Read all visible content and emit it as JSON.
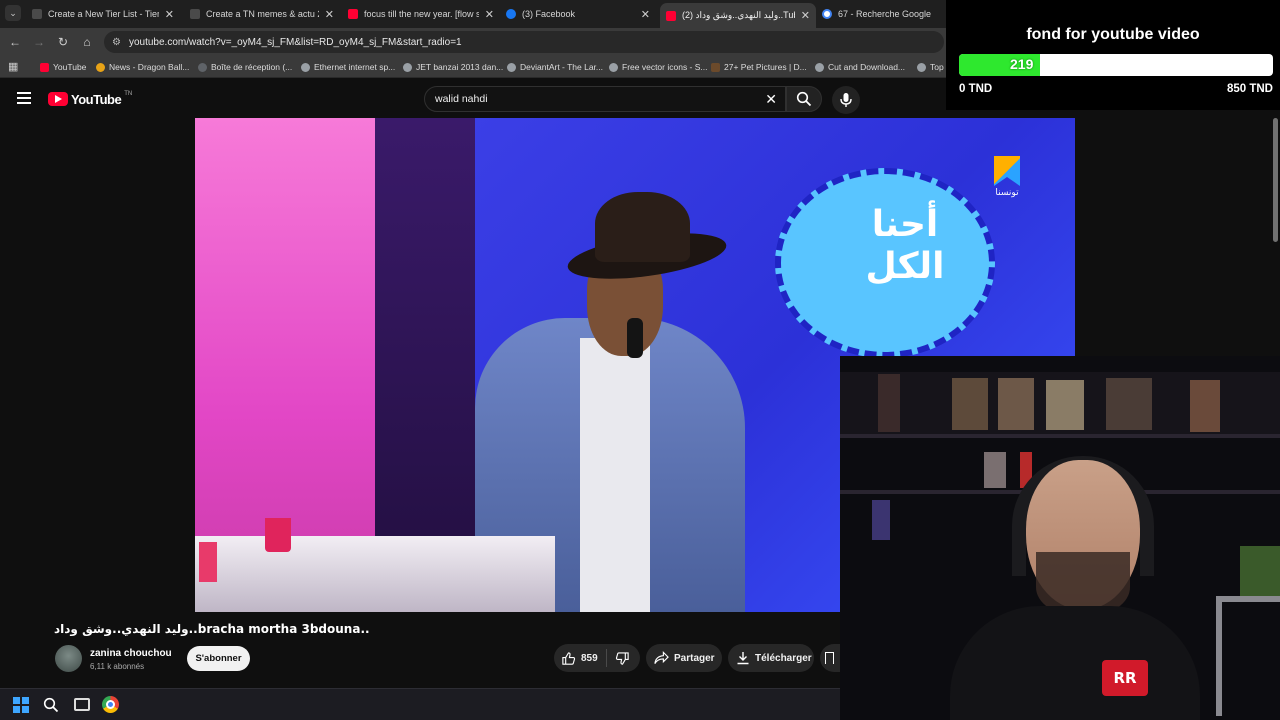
{
  "browser": {
    "tabs": [
      {
        "title": "Create a New Tier List - TierMaker",
        "favicon_color": "#2b2b2b",
        "active": false
      },
      {
        "title": "Create a TN memes & actu 2024",
        "favicon_color": "#2b2b2b",
        "active": false
      },
      {
        "title": "focus till the new year. [flow state]",
        "favicon_color": "#ff0033",
        "active": false
      },
      {
        "title": "(3) Facebook",
        "favicon_color": "#1877f2",
        "active": false
      },
      {
        "title": "(2) وليد النهدي..وشق وداد..Tube",
        "favicon_color": "#ff0033",
        "active": true
      },
      {
        "title": "67 - Recherche Google",
        "favicon_color": "#4285f4",
        "active": false
      }
    ],
    "url": "youtube.com/watch?v=_oyM4_sj_FM&list=RD_oyM4_sj_FM&start_radio=1",
    "bookmarks": [
      "YouTube",
      "News - Dragon Ball...",
      "Boîte de réception (...",
      "Ethernet internet sp...",
      "JET banzai 2013 dan...",
      "DeviantArt - The Lar...",
      "Free vector icons - S...",
      "27+ Pet Pictures | D...",
      "Cut and Download...",
      "Top"
    ]
  },
  "youtube": {
    "logo": "YouTube",
    "country_code": "TN",
    "search_query": "walid nahdi",
    "video": {
      "title": "وليد النهدي..وشق وداد..bracha mortha 3bdouna..",
      "channel": "zanina chouchou",
      "subscribers": "6,11 k abonnés",
      "subscribe_label": "S'abonner",
      "likes": "859",
      "share_label": "Partager",
      "download_label": "Télécharger",
      "tv_logo_text": "تونسنا",
      "show_title_line1": "أحنا",
      "show_title_line2": "الكل"
    }
  },
  "donation": {
    "title": "fond for youtube video",
    "current": "219",
    "progress_fraction": 0.2576,
    "min_label": "0 TND",
    "max_label": "850 TND",
    "bar_color": "#2ee82e"
  }
}
